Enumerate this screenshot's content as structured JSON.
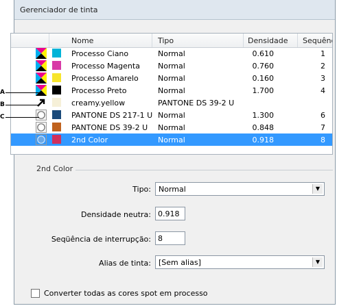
{
  "window": {
    "title": "Gerenciador de tinta"
  },
  "table": {
    "headers": {
      "name": "Nome",
      "type": "Tipo",
      "density": "Densidade",
      "sequence": "Sequênc"
    },
    "rows": [
      {
        "icon": "process-cmyk-icon",
        "swatch": "#00b4d8",
        "name": "Processo Ciano",
        "type": "Normal",
        "density": "0.610",
        "sequence": "1"
      },
      {
        "icon": "process-cmyk-icon",
        "swatch": "#d83aa6",
        "name": "Processo Magenta",
        "type": "Normal",
        "density": "0.760",
        "sequence": "2"
      },
      {
        "icon": "process-cmyk-icon",
        "swatch": "#f7e52c",
        "name": "Processo Amarelo",
        "type": "Normal",
        "density": "0.160",
        "sequence": "3"
      },
      {
        "icon": "process-cmyk-icon",
        "swatch": "#000000",
        "name": "Processo Preto",
        "type": "Normal",
        "density": "1.700",
        "sequence": "4"
      },
      {
        "icon": "alias-arrow-icon",
        "swatch": "#f6f0d8",
        "name": "creamy.yellow",
        "type": "PANTONE DS 39-2 U",
        "density": "",
        "sequence": ""
      },
      {
        "icon": "spot-color-icon",
        "swatch": "#1a4a7a",
        "name": "PANTONE DS 217-1 U",
        "type": "Normal",
        "density": "1.300",
        "sequence": "6"
      },
      {
        "icon": "spot-color-icon",
        "swatch": "#c0621e",
        "name": "PANTONE DS 39-2 U",
        "type": "Normal",
        "density": "0.848",
        "sequence": "7"
      },
      {
        "icon": "spot-color-icon",
        "swatch": "#d0305c",
        "name": "2nd Color",
        "type": "Normal",
        "density": "0.918",
        "sequence": "8",
        "selected": true
      }
    ]
  },
  "callouts": [
    "A",
    "B",
    "C"
  ],
  "details": {
    "section_title": "2nd Color",
    "type_label": "Tipo:",
    "type_value": "Normal",
    "density_label": "Densidade neutra:",
    "density_value": "0.918",
    "sequence_label": "Seqüência de interrupção:",
    "sequence_value": "8",
    "alias_label": "Alias de tinta:",
    "alias_value": "[Sem alias]"
  },
  "convert_checkbox": {
    "label": "Converter todas as cores spot em processo",
    "checked": false
  },
  "colors": {
    "selection": "#3399ff"
  }
}
